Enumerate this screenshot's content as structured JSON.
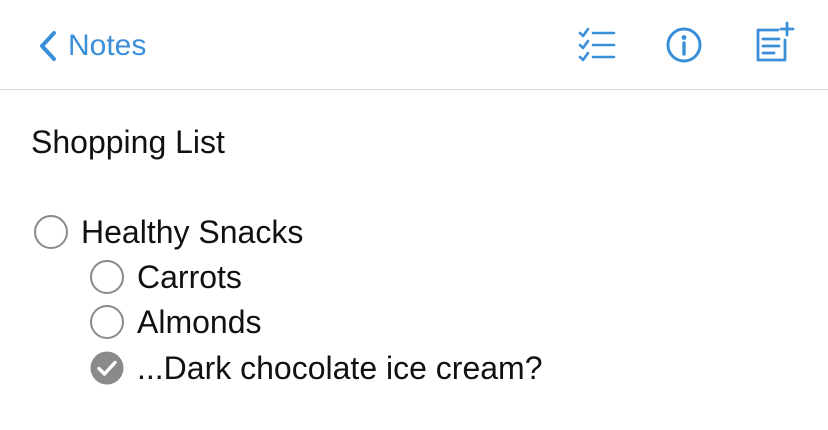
{
  "nav": {
    "back_label": "Notes",
    "accent_color": "#3b8fd9",
    "icons": [
      "back-chevron-icon",
      "checklist-icon",
      "info-icon",
      "new-note-icon"
    ]
  },
  "note": {
    "title": "Shopping List",
    "items": [
      {
        "label": "Healthy Snacks",
        "checked": false,
        "level": 0
      },
      {
        "label": "Carrots",
        "checked": false,
        "level": 1
      },
      {
        "label": "Almonds",
        "checked": false,
        "level": 1
      },
      {
        "label": "...Dark chocolate ice cream?",
        "checked": true,
        "level": 1
      }
    ]
  }
}
